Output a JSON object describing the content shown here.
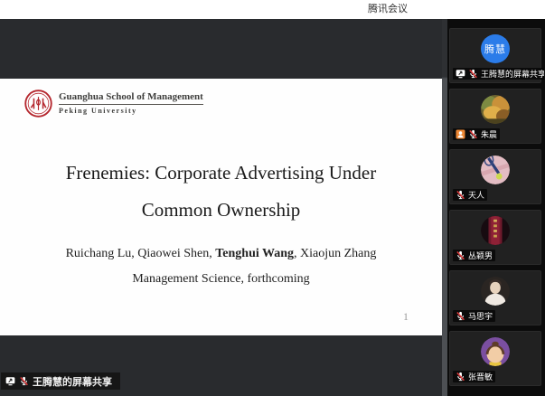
{
  "window": {
    "title": "腾讯会议"
  },
  "slide": {
    "logo_line1": "Guanghua School of Management",
    "logo_line2": "Peking University",
    "title_line1": "Frenemies: Corporate Advertising Under",
    "title_line2": "Common Ownership",
    "authors_prefix": "Ruichang Lu, Qiaowei Shen, ",
    "authors_bold": "Tenghui Wang",
    "authors_suffix": ", Xiaojun Zhang",
    "journal_line": "Management Science, forthcoming",
    "page_number": "1"
  },
  "share_banner": {
    "label": "王腾慧的屏幕共享"
  },
  "participants": [
    {
      "name": "王腾慧的屏幕共享",
      "avatar_text": "腾慧",
      "muted": true,
      "sharing": true
    },
    {
      "name": "朱晨",
      "muted": true,
      "has_person_badge": true
    },
    {
      "name": "天人",
      "muted": true
    },
    {
      "name": "丛颖男",
      "muted": true
    },
    {
      "name": "马思宇",
      "muted": true
    },
    {
      "name": "张晋敏",
      "muted": true
    }
  ],
  "colors": {
    "avatar_blue": "#2b7ce9",
    "muted_mic_red": "#e23b3c",
    "person_badge_orange": "#ed8733",
    "pku_seal_red": "#b5282f"
  }
}
